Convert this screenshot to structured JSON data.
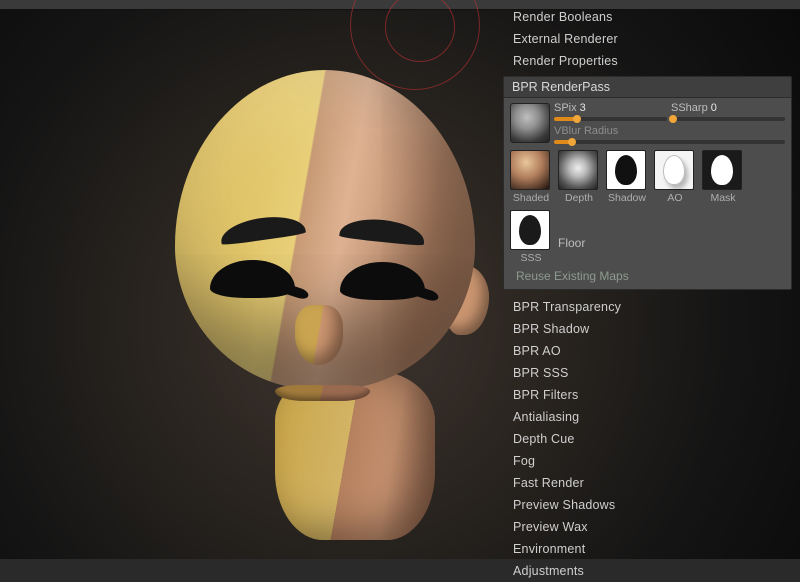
{
  "menu_top": [
    "Render Booleans",
    "External Renderer",
    "Render Properties"
  ],
  "renderpass": {
    "title": "BPR RenderPass",
    "bpr_label": "BPR",
    "spix": {
      "label": "SPix",
      "value": "3",
      "percent": 20
    },
    "ssharp": {
      "label": "SSharp",
      "value": "0",
      "percent": 0
    },
    "vblur": {
      "label": "VBlur Radius",
      "percent": 8
    },
    "thumbs": [
      {
        "key": "shaded",
        "label": "Shaded"
      },
      {
        "key": "depth",
        "label": "Depth"
      },
      {
        "key": "shadow",
        "label": "Shadow"
      },
      {
        "key": "ao",
        "label": "AO"
      },
      {
        "key": "mask",
        "label": "Mask"
      },
      {
        "key": "sss",
        "label": "SSS"
      },
      {
        "key": "floor",
        "label": "Floor"
      }
    ],
    "reuse": "Reuse Existing Maps"
  },
  "menu_bottom": [
    "BPR Transparency",
    "BPR Shadow",
    "BPR AO",
    "BPR SSS",
    "BPR Filters",
    "Antialiasing",
    "Depth Cue",
    "Fog",
    "Fast Render",
    "Preview Shadows",
    "Preview Wax",
    "Environment",
    "Adjustments"
  ]
}
